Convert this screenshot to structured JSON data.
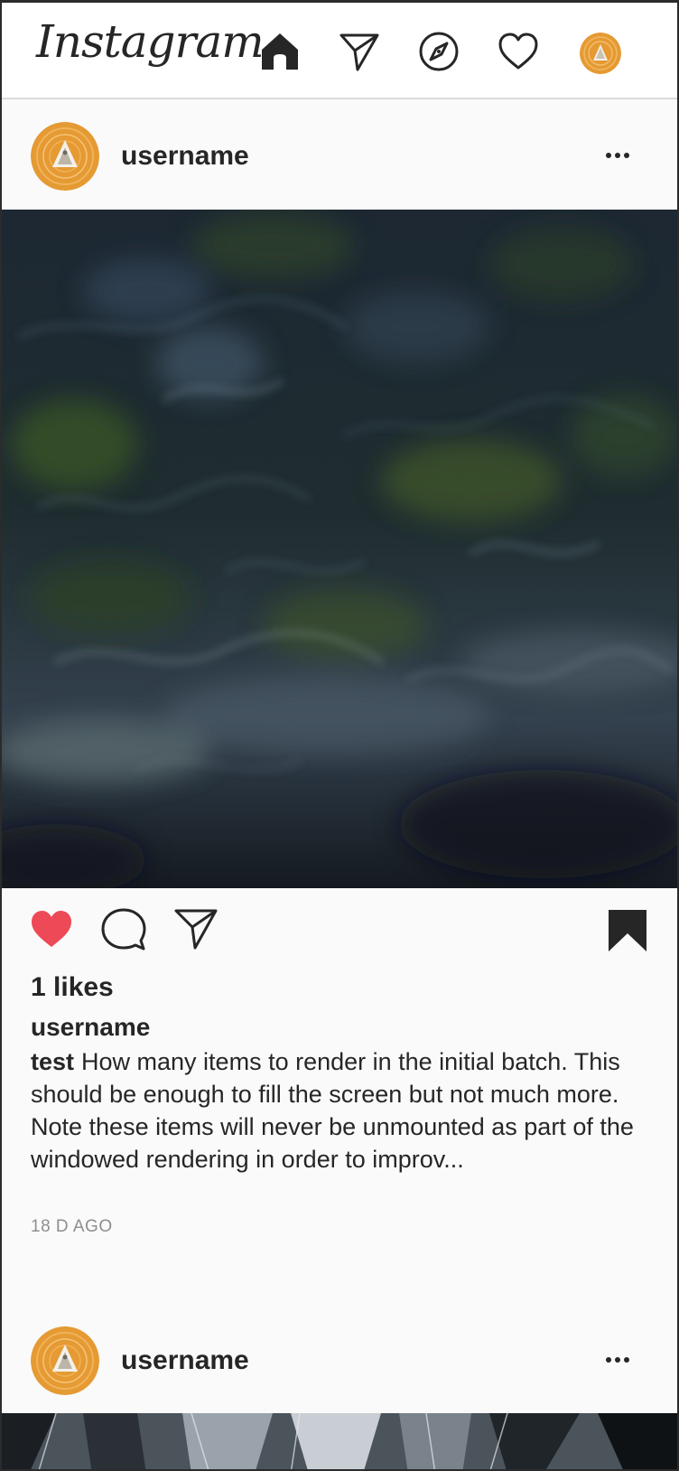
{
  "header": {
    "logo_text": "Instagram",
    "nav_icons": [
      "home-icon",
      "direct-icon",
      "explore-icon",
      "activity-heart-icon",
      "profile-avatar"
    ]
  },
  "posts": [
    {
      "username": "username",
      "likes_text": "1 likes",
      "caption_username": "username",
      "caption_author": "test",
      "caption_text": "How many items to render in the initial batch. This should be enough to fill the screen but not much more. Note these items will never be unmounted as part of the windowed rendering in order to improv...",
      "timestamp": "18 D AGO",
      "liked": true,
      "saved": true
    },
    {
      "username": "username"
    }
  ],
  "colors": {
    "like_red": "#ed4956",
    "text": "#262626",
    "muted": "#8e8e8e",
    "avatar_orange": "#e59a33"
  }
}
